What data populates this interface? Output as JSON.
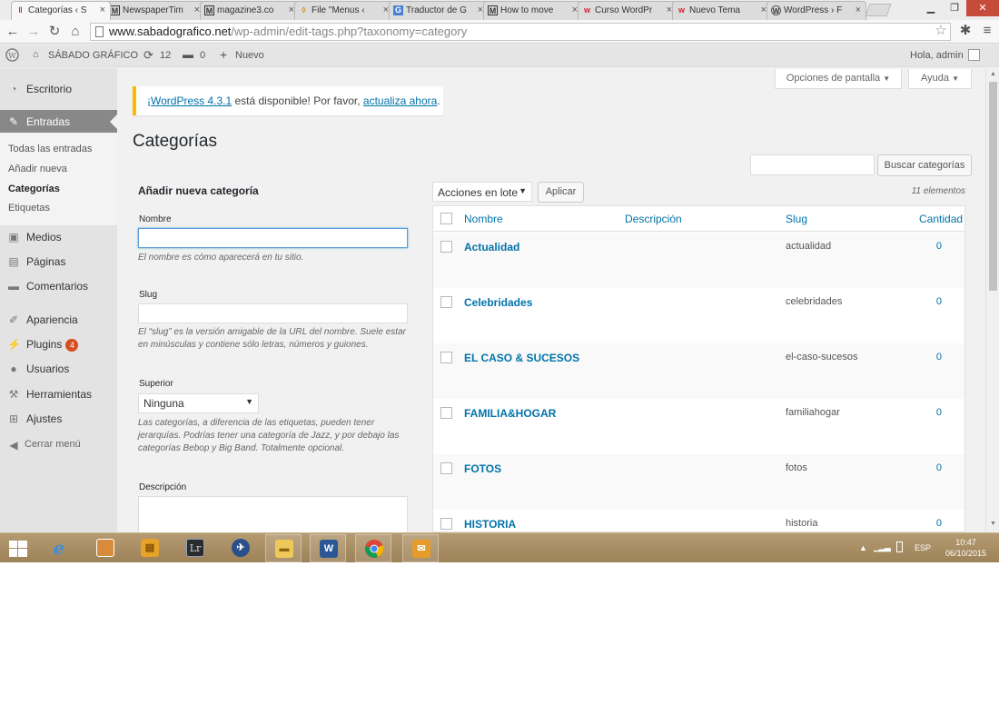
{
  "browser": {
    "tabs": [
      {
        "title": "Categorías ‹ S",
        "icon": "wordpress-favicon-icon",
        "active": true
      },
      {
        "title": "NewspaperTim",
        "icon": "m-favicon-icon",
        "active": false
      },
      {
        "title": "magazine3.co",
        "icon": "m-favicon-icon",
        "active": false
      },
      {
        "title": "File \"Menus ‹",
        "icon": "document-favicon-icon",
        "active": false
      },
      {
        "title": "Traductor de G",
        "icon": "translate-favicon-icon",
        "active": false
      },
      {
        "title": "How to move",
        "icon": "m-favicon-icon",
        "active": false
      },
      {
        "title": "Curso WordPr",
        "icon": "w-favicon-icon",
        "active": false
      },
      {
        "title": "Nuevo Tema",
        "icon": "w-favicon-icon",
        "active": false
      },
      {
        "title": "WordPress › F",
        "icon": "wordpress-favicon-icon",
        "active": false
      }
    ],
    "url_host": "www.sabadografico.net",
    "url_path": "/wp-admin/edit-tags.php?taxonomy=category"
  },
  "adminbar": {
    "site_name": "SÁBADO GRÁFICO",
    "updates_count": "12",
    "comments_count": "0",
    "new_label": "Nuevo",
    "greeting": "Hola, admin"
  },
  "sidebar": {
    "items": [
      {
        "label": "Escritorio",
        "icon": "dashboard-icon"
      },
      {
        "label": "Entradas",
        "icon": "pin-icon"
      },
      {
        "label": "Medios",
        "icon": "media-icon"
      },
      {
        "label": "Páginas",
        "icon": "pages-icon"
      },
      {
        "label": "Comentarios",
        "icon": "comments-icon"
      },
      {
        "label": "Apariencia",
        "icon": "brush-icon"
      },
      {
        "label": "Plugins",
        "icon": "plugin-icon",
        "badge": "4"
      },
      {
        "label": "Usuarios",
        "icon": "users-icon"
      },
      {
        "label": "Herramientas",
        "icon": "wrench-icon"
      },
      {
        "label": "Ajustes",
        "icon": "settings-icon"
      }
    ],
    "submenu": [
      "Todas las entradas",
      "Añadir nueva",
      "Categorías",
      "Etiquetas"
    ],
    "collapse_label": "Cerrar menú"
  },
  "header": {
    "screen_options": "Opciones de pantalla",
    "help": "Ayuda"
  },
  "notice": {
    "link1": "¡WordPress 4.3.1",
    "text": " está disponible! Por favor, ",
    "link2": "actualiza ahora",
    "end": "."
  },
  "page_title": "Categorías",
  "search": {
    "button": "Buscar categorías",
    "value": ""
  },
  "form": {
    "title": "Añadir nueva categoría",
    "name_label": "Nombre",
    "name_help": "El nombre es cómo aparecerá en tu sitio.",
    "slug_label": "Slug",
    "slug_help": "El “slug” es la versión amigable de la URL del nombre. Suele estar en minúsculas y contiene sólo letras, números y guiones.",
    "parent_label": "Superior",
    "parent_value": "Ninguna",
    "parent_help": "Las categorías, a diferencia de las etiquetas, pueden tener jerarquías. Podrías tener una categoría de Jazz, y por debajo las categorías Bebop y Big Band. Totalmente opcional.",
    "desc_label": "Descripción"
  },
  "table": {
    "bulk_action": "Acciones en lote",
    "apply": "Aplicar",
    "item_count": "11 elementos",
    "columns": {
      "name": "Nombre",
      "description": "Descripción",
      "slug": "Slug",
      "count": "Cantidad"
    },
    "rows": [
      {
        "name": "Actualidad",
        "slug": "actualidad",
        "count": "0"
      },
      {
        "name": "Celebridades",
        "slug": "celebridades",
        "count": "0"
      },
      {
        "name": "EL CASO & SUCESOS",
        "slug": "el-caso-sucesos",
        "count": "0"
      },
      {
        "name": "FAMILIA&HOGAR",
        "slug": "familiahogar",
        "count": "0"
      },
      {
        "name": "FOTOS",
        "slug": "fotos",
        "count": "0"
      },
      {
        "name": "HISTORIA",
        "slug": "historia",
        "count": "0"
      }
    ]
  },
  "taskbar": {
    "apps": [
      "windows-start-icon",
      "internet-explorer-icon",
      "package-app-icon",
      "archive-app-icon",
      "lightroom-icon",
      "network-app-icon",
      "file-explorer-icon",
      "word-icon",
      "chrome-icon",
      "outlook-icon"
    ],
    "lightroom_label": "Lr",
    "word_label": "W",
    "language": "ESP",
    "time": "10:47",
    "date": "06/10/2015"
  },
  "colors": {
    "accent": "#0073aa",
    "notice_border": "#ffba00",
    "badge": "#d54e21"
  }
}
